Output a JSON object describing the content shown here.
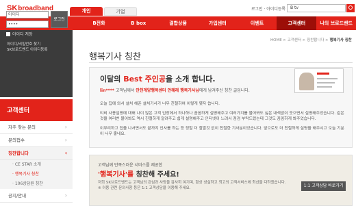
{
  "header": {
    "logo_sk": "SK",
    "logo_text": "broadband",
    "tabs": [
      "개인",
      "기업"
    ],
    "login_info": "로그인 · 아이디등록 · 사이트맵",
    "search_value": "B tv"
  },
  "nav": {
    "items": [
      "B인터넷",
      "B tv",
      "B전화",
      "B box",
      "결합상품",
      "가입센터",
      "이벤트",
      "고객센터",
      "나의 브로드밴드"
    ],
    "active_index": 7
  },
  "login": {
    "id_placeholder": "아이디",
    "pw_value": "••••",
    "login_button": "로그인",
    "save_id": "아이디 저장",
    "links": [
      "아이디/비밀번호 찾기",
      "SK브로드밴드 아이디등록"
    ]
  },
  "sidebar": {
    "title": "고객센터",
    "items": [
      "자주 찾는 문의",
      "문의접수",
      "칭찬합니다"
    ],
    "sub_items": [
      "· CE STAR 소개",
      "· 행복기사 칭찬",
      "· 106상담원 칭찬"
    ],
    "after_items": [
      "공지/안내"
    ],
    "active_item": "칭찬합니다",
    "active_sub": "· 행복기사 칭찬"
  },
  "breadcrumb": {
    "text": "HOME > 고객센터 > 칭찬합니다 >",
    "current": "행복기사 칭찬"
  },
  "main": {
    "page_title": "행복기사 칭찬",
    "card": {
      "heading_pre": "이달의 ",
      "heading_red": "Best 주인공",
      "heading_post": "을 소개 합니다.",
      "subline_name": "lin****",
      "subline_mid": " 고객님께서 ",
      "subline_hl": "안천계양행복센터 안혜래 행복기사님",
      "subline_post": "에게 남겨주신 칭찬 글입니다.",
      "paragraphs": [
        "오늘 집에 와서 설치 해준 설치기사가 너무 친절하여 이렇게 몇자 씁니다.",
        "티비 사용설명에 대해 나이 많은 고객 입장에서 하나하나 꼼꼼하게 설명해주고 여러가지를 물어봐도 싫은 내색없이 웃으면서 설명해주었습니다. 같은 것을 여러번 물어봐도 역시 친절하게 알려주고 쉽게 설명해주고 인터넷이 느려서 점검 부탁드렸는데 그것도 꼼꼼하게 봐주었습니다.",
        "이무리하고 집을 나서면서도 끝까지 인사를 하는 등 정말 더 할말것 없이 친절한 기사분이었습니다. 앞으로도 더 친절하게 설명을 해주시고 오늘 기분이 너무 좋네요."
      ]
    },
    "promo": {
      "top_text": "고객님께 만족스러운 서비스를 제공한",
      "title_pre": "'행복기사'를 ",
      "title_post": "칭찬해 주세요!",
      "note": "저희 SK브로드밴드는 고객님의 관심과 사랑을 감사히 여기며, 항상 성실하고 최고의 고객서비스에 최선을 다하겠습니다. ※ 이용 관련 문의사항 등은 1:1 고객상담을 이용해 주세요.",
      "button": "1:1 고객상담 바로가기"
    }
  },
  "colors": {
    "brand_red": "#e2231a",
    "nav_active": "#9c0e08",
    "sidebar_dark": "#3b3b3b"
  }
}
